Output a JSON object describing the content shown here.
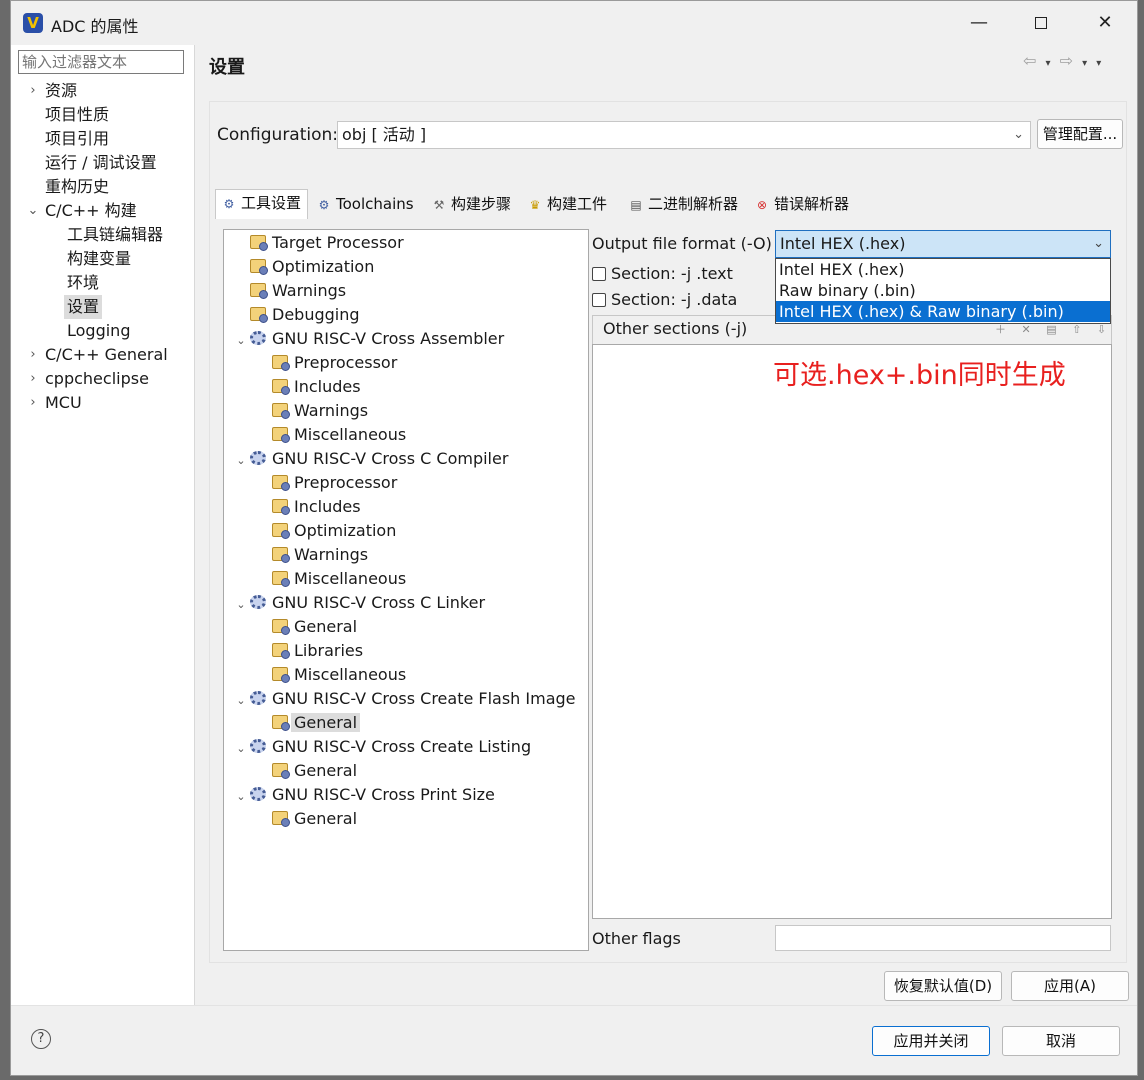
{
  "window": {
    "title": "ADC 的属性",
    "logo_letter": "V",
    "controls": {
      "minimize": "—",
      "close": "✕"
    }
  },
  "filter": {
    "placeholder": "输入过滤器文本"
  },
  "nav": {
    "items": [
      {
        "label": "资源",
        "chevron": "›",
        "level": 0
      },
      {
        "label": "项目性质",
        "chevron": "",
        "level": 0
      },
      {
        "label": "项目引用",
        "chevron": "",
        "level": 0
      },
      {
        "label": "运行 / 调试设置",
        "chevron": "",
        "level": 0
      },
      {
        "label": "重构历史",
        "chevron": "",
        "level": 0
      },
      {
        "label": "C/C++ 构建",
        "chevron": "⌄",
        "level": 0
      },
      {
        "label": "工具链编辑器",
        "chevron": "",
        "level": 1
      },
      {
        "label": "构建变量",
        "chevron": "",
        "level": 1
      },
      {
        "label": "环境",
        "chevron": "",
        "level": 1
      },
      {
        "label": "设置",
        "chevron": "",
        "level": 1,
        "selected": true
      },
      {
        "label": "Logging",
        "chevron": "",
        "level": 1
      },
      {
        "label": "C/C++ General",
        "chevron": "›",
        "level": 0
      },
      {
        "label": "cppcheclipse",
        "chevron": "›",
        "level": 0
      },
      {
        "label": "MCU",
        "chevron": "›",
        "level": 0
      }
    ]
  },
  "page": {
    "title": "设置",
    "back_arrow": "⇦",
    "forward_arrow": "⇨",
    "menu_arrow": "▾"
  },
  "configuration": {
    "label": "Configuration:",
    "value": "obj  [ 活动 ]",
    "manage_button": "管理配置..."
  },
  "tabs": [
    {
      "label": "工具设置",
      "icon": "gear-icon",
      "active": true
    },
    {
      "label": "Toolchains",
      "icon": "gear-icon"
    },
    {
      "label": "构建步骤",
      "icon": "wrench-icon"
    },
    {
      "label": "构建工件",
      "icon": "trophy-icon"
    },
    {
      "label": "二进制解析器",
      "icon": "binary-icon"
    },
    {
      "label": "错误解析器",
      "icon": "error-icon"
    }
  ],
  "tool_tree": [
    {
      "label": "Target Processor",
      "level": 1,
      "type": "folder"
    },
    {
      "label": "Optimization",
      "level": 1,
      "type": "folder"
    },
    {
      "label": "Warnings",
      "level": 1,
      "type": "folder"
    },
    {
      "label": "Debugging",
      "level": 1,
      "type": "folder"
    },
    {
      "label": "GNU RISC-V Cross Assembler",
      "level": 1,
      "type": "tool"
    },
    {
      "label": "Preprocessor",
      "level": 2,
      "type": "folder"
    },
    {
      "label": "Includes",
      "level": 2,
      "type": "folder"
    },
    {
      "label": "Warnings",
      "level": 2,
      "type": "folder"
    },
    {
      "label": "Miscellaneous",
      "level": 2,
      "type": "folder"
    },
    {
      "label": "GNU RISC-V Cross C Compiler",
      "level": 1,
      "type": "tool"
    },
    {
      "label": "Preprocessor",
      "level": 2,
      "type": "folder"
    },
    {
      "label": "Includes",
      "level": 2,
      "type": "folder"
    },
    {
      "label": "Optimization",
      "level": 2,
      "type": "folder"
    },
    {
      "label": "Warnings",
      "level": 2,
      "type": "folder"
    },
    {
      "label": "Miscellaneous",
      "level": 2,
      "type": "folder"
    },
    {
      "label": "GNU RISC-V Cross C Linker",
      "level": 1,
      "type": "tool"
    },
    {
      "label": "General",
      "level": 2,
      "type": "folder"
    },
    {
      "label": "Libraries",
      "level": 2,
      "type": "folder"
    },
    {
      "label": "Miscellaneous",
      "level": 2,
      "type": "folder"
    },
    {
      "label": "GNU RISC-V Cross Create Flash Image",
      "level": 1,
      "type": "tool"
    },
    {
      "label": "General",
      "level": 2,
      "type": "folder",
      "selected": true
    },
    {
      "label": "GNU RISC-V Cross Create Listing",
      "level": 1,
      "type": "tool"
    },
    {
      "label": "General",
      "level": 2,
      "type": "folder"
    },
    {
      "label": "GNU RISC-V Cross Print Size",
      "level": 1,
      "type": "tool"
    },
    {
      "label": "General",
      "level": 2,
      "type": "folder"
    }
  ],
  "output_format": {
    "label": "Output file format (-O)",
    "value": "Intel HEX (.hex)",
    "options": [
      {
        "label": "Intel HEX (.hex)"
      },
      {
        "label": "Raw binary (.bin)"
      },
      {
        "label": "Intel HEX (.hex) & Raw binary (.bin)",
        "highlighted": true
      }
    ]
  },
  "checkboxes": {
    "text": "Section: -j .text",
    "data": "Section: -j .data"
  },
  "other_sections": {
    "label": "Other sections (-j)",
    "toolbar": "＋ ✕ ▤ ⇧ ⇩"
  },
  "annotation": {
    "text": "可选.hex+.bin同时生成",
    "color": "#e8201f"
  },
  "other_flags": {
    "label": "Other flags",
    "value": ""
  },
  "buttons": {
    "restore": "恢复默认值(D)",
    "apply": "应用(A)",
    "apply_close": "应用并关闭",
    "cancel": "取消"
  },
  "help": {
    "glyph": "?"
  }
}
